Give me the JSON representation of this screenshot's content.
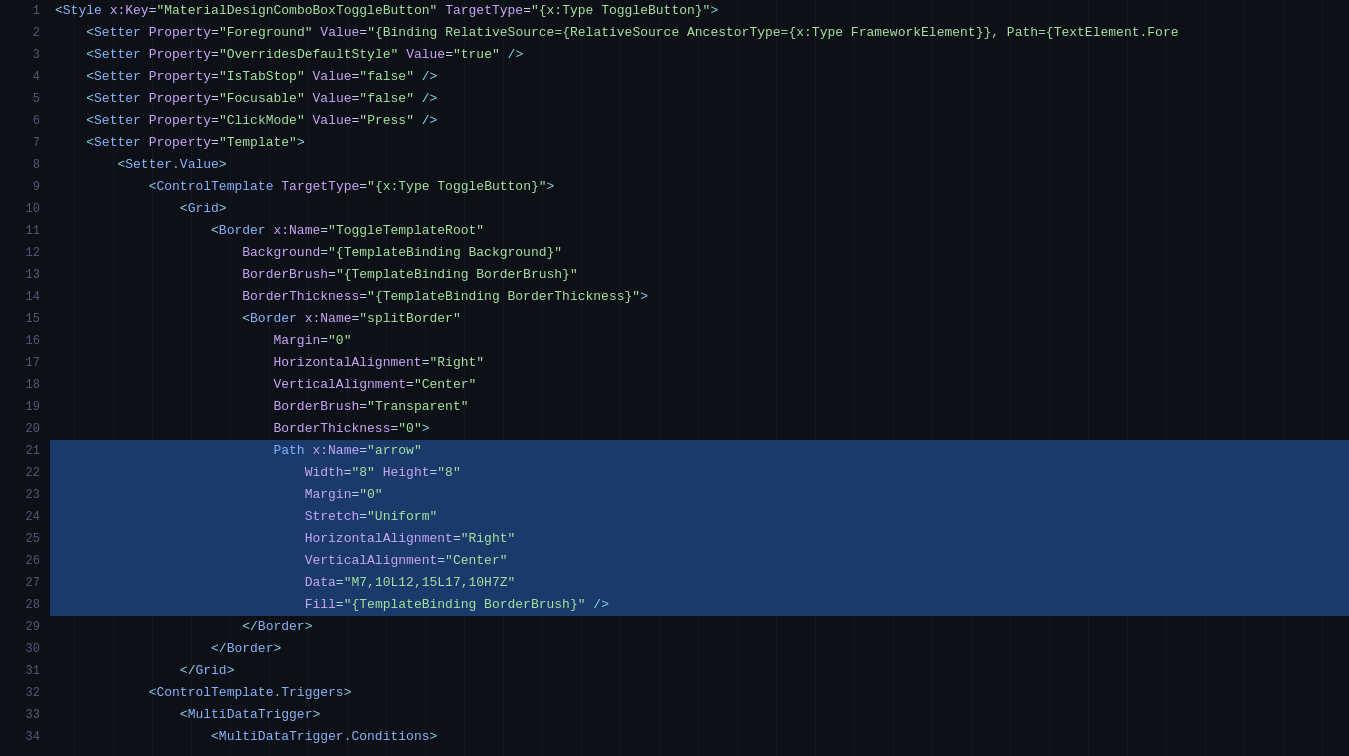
{
  "editor": {
    "background": "#0d1117",
    "lines": [
      {
        "number": 1,
        "indent": 0,
        "selected": false,
        "tokens": [
          {
            "type": "tag-bracket",
            "text": "<"
          },
          {
            "type": "tag-name",
            "text": "Style"
          },
          {
            "type": "text-normal",
            "text": " "
          },
          {
            "type": "attr-name",
            "text": "x:Key"
          },
          {
            "type": "text-normal",
            "text": "="
          },
          {
            "type": "attr-value",
            "text": "\"MaterialDesignComboBoxToggleButton\""
          },
          {
            "type": "text-normal",
            "text": " "
          },
          {
            "type": "attr-name",
            "text": "TargetType"
          },
          {
            "type": "text-normal",
            "text": "="
          },
          {
            "type": "attr-value",
            "text": "\"{x:Type ToggleButton}\""
          },
          {
            "type": "tag-bracket",
            "text": ">"
          }
        ]
      },
      {
        "number": 2,
        "indent": 1,
        "selected": false,
        "tokens": [
          {
            "type": "tag-bracket",
            "text": "<"
          },
          {
            "type": "tag-name",
            "text": "Setter"
          },
          {
            "type": "text-normal",
            "text": " "
          },
          {
            "type": "attr-name",
            "text": "Property"
          },
          {
            "type": "text-normal",
            "text": "="
          },
          {
            "type": "attr-value",
            "text": "\"Foreground\""
          },
          {
            "type": "text-normal",
            "text": " "
          },
          {
            "type": "attr-name",
            "text": "Value"
          },
          {
            "type": "text-normal",
            "text": "="
          },
          {
            "type": "attr-value",
            "text": "\"{Binding RelativeSource={RelativeSource AncestorType={x:Type FrameworkElement}}, Path={TextElement.Fore"
          }
        ]
      },
      {
        "number": 3,
        "indent": 1,
        "selected": false,
        "tokens": [
          {
            "type": "tag-bracket",
            "text": "<"
          },
          {
            "type": "tag-name",
            "text": "Setter"
          },
          {
            "type": "text-normal",
            "text": " "
          },
          {
            "type": "attr-name",
            "text": "Property"
          },
          {
            "type": "text-normal",
            "text": "="
          },
          {
            "type": "attr-value",
            "text": "\"OverridesDefaultStyle\""
          },
          {
            "type": "text-normal",
            "text": " "
          },
          {
            "type": "attr-name",
            "text": "Value"
          },
          {
            "type": "text-normal",
            "text": "="
          },
          {
            "type": "attr-value",
            "text": "\"true\""
          },
          {
            "type": "text-normal",
            "text": " "
          },
          {
            "type": "slash",
            "text": "/>"
          }
        ]
      },
      {
        "number": 4,
        "indent": 1,
        "selected": false,
        "tokens": [
          {
            "type": "tag-bracket",
            "text": "<"
          },
          {
            "type": "tag-name",
            "text": "Setter"
          },
          {
            "type": "text-normal",
            "text": " "
          },
          {
            "type": "attr-name",
            "text": "Property"
          },
          {
            "type": "text-normal",
            "text": "="
          },
          {
            "type": "attr-value",
            "text": "\"IsTabStop\""
          },
          {
            "type": "text-normal",
            "text": " "
          },
          {
            "type": "attr-name",
            "text": "Value"
          },
          {
            "type": "text-normal",
            "text": "="
          },
          {
            "type": "attr-value",
            "text": "\"false\""
          },
          {
            "type": "text-normal",
            "text": " "
          },
          {
            "type": "slash",
            "text": "/>"
          }
        ]
      },
      {
        "number": 5,
        "indent": 1,
        "selected": false,
        "tokens": [
          {
            "type": "tag-bracket",
            "text": "<"
          },
          {
            "type": "tag-name",
            "text": "Setter"
          },
          {
            "type": "text-normal",
            "text": " "
          },
          {
            "type": "attr-name",
            "text": "Property"
          },
          {
            "type": "text-normal",
            "text": "="
          },
          {
            "type": "attr-value",
            "text": "\"Focusable\""
          },
          {
            "type": "text-normal",
            "text": " "
          },
          {
            "type": "attr-name",
            "text": "Value"
          },
          {
            "type": "text-normal",
            "text": "="
          },
          {
            "type": "attr-value",
            "text": "\"false\""
          },
          {
            "type": "text-normal",
            "text": " "
          },
          {
            "type": "slash",
            "text": "/>"
          }
        ]
      },
      {
        "number": 6,
        "indent": 1,
        "selected": false,
        "tokens": [
          {
            "type": "tag-bracket",
            "text": "<"
          },
          {
            "type": "tag-name",
            "text": "Setter"
          },
          {
            "type": "text-normal",
            "text": " "
          },
          {
            "type": "attr-name",
            "text": "Property"
          },
          {
            "type": "text-normal",
            "text": "="
          },
          {
            "type": "attr-value",
            "text": "\"ClickMode\""
          },
          {
            "type": "text-normal",
            "text": " "
          },
          {
            "type": "attr-name",
            "text": "Value"
          },
          {
            "type": "text-normal",
            "text": "="
          },
          {
            "type": "attr-value",
            "text": "\"Press\""
          },
          {
            "type": "text-normal",
            "text": " "
          },
          {
            "type": "slash",
            "text": "/>"
          }
        ]
      },
      {
        "number": 7,
        "indent": 1,
        "selected": false,
        "tokens": [
          {
            "type": "tag-bracket",
            "text": "<"
          },
          {
            "type": "tag-name",
            "text": "Setter"
          },
          {
            "type": "text-normal",
            "text": " "
          },
          {
            "type": "attr-name",
            "text": "Property"
          },
          {
            "type": "text-normal",
            "text": "="
          },
          {
            "type": "attr-value",
            "text": "\"Template\""
          },
          {
            "type": "tag-bracket",
            "text": ">"
          }
        ]
      },
      {
        "number": 8,
        "indent": 2,
        "selected": false,
        "tokens": [
          {
            "type": "tag-bracket",
            "text": "<"
          },
          {
            "type": "tag-name",
            "text": "Setter.Value"
          },
          {
            "type": "tag-bracket",
            "text": ">"
          }
        ]
      },
      {
        "number": 9,
        "indent": 3,
        "selected": false,
        "tokens": [
          {
            "type": "tag-bracket",
            "text": "<"
          },
          {
            "type": "tag-name",
            "text": "ControlTemplate"
          },
          {
            "type": "text-normal",
            "text": " "
          },
          {
            "type": "attr-name",
            "text": "TargetType"
          },
          {
            "type": "text-normal",
            "text": "="
          },
          {
            "type": "attr-value",
            "text": "\"{x:Type ToggleButton}\""
          },
          {
            "type": "tag-bracket",
            "text": ">"
          }
        ]
      },
      {
        "number": 10,
        "indent": 4,
        "selected": false,
        "tokens": [
          {
            "type": "tag-bracket",
            "text": "<"
          },
          {
            "type": "tag-name",
            "text": "Grid"
          },
          {
            "type": "tag-bracket",
            "text": ">"
          }
        ]
      },
      {
        "number": 11,
        "indent": 5,
        "selected": false,
        "tokens": [
          {
            "type": "tag-bracket",
            "text": "<"
          },
          {
            "type": "tag-name",
            "text": "Border"
          },
          {
            "type": "text-normal",
            "text": " "
          },
          {
            "type": "attr-name",
            "text": "x:Name"
          },
          {
            "type": "text-normal",
            "text": "="
          },
          {
            "type": "attr-value",
            "text": "\"ToggleTemplateRoot\""
          }
        ]
      },
      {
        "number": 12,
        "indent": 6,
        "selected": false,
        "tokens": [
          {
            "type": "attr-name",
            "text": "Background"
          },
          {
            "type": "text-normal",
            "text": "="
          },
          {
            "type": "attr-value",
            "text": "\"{TemplateBinding Background}\""
          }
        ]
      },
      {
        "number": 13,
        "indent": 6,
        "selected": false,
        "tokens": [
          {
            "type": "attr-name",
            "text": "BorderBrush"
          },
          {
            "type": "text-normal",
            "text": "="
          },
          {
            "type": "attr-value",
            "text": "\"{TemplateBinding BorderBrush}\""
          }
        ]
      },
      {
        "number": 14,
        "indent": 6,
        "selected": false,
        "tokens": [
          {
            "type": "attr-name",
            "text": "BorderThickness"
          },
          {
            "type": "text-normal",
            "text": "="
          },
          {
            "type": "attr-value",
            "text": "\"{TemplateBinding BorderThickness}\""
          },
          {
            "type": "tag-bracket",
            "text": ">"
          }
        ]
      },
      {
        "number": 15,
        "indent": 6,
        "selected": false,
        "tokens": [
          {
            "type": "tag-bracket",
            "text": "<"
          },
          {
            "type": "tag-name",
            "text": "Border"
          },
          {
            "type": "text-normal",
            "text": " "
          },
          {
            "type": "attr-name",
            "text": "x:Name"
          },
          {
            "type": "text-normal",
            "text": "="
          },
          {
            "type": "attr-value",
            "text": "\"splitBorder\""
          }
        ]
      },
      {
        "number": 16,
        "indent": 7,
        "selected": false,
        "tokens": [
          {
            "type": "attr-name",
            "text": "Margin"
          },
          {
            "type": "text-normal",
            "text": "="
          },
          {
            "type": "attr-value",
            "text": "\"0\""
          }
        ]
      },
      {
        "number": 17,
        "indent": 7,
        "selected": false,
        "tokens": [
          {
            "type": "attr-name",
            "text": "HorizontalAlignment"
          },
          {
            "type": "text-normal",
            "text": "="
          },
          {
            "type": "attr-value",
            "text": "\"Right\""
          }
        ]
      },
      {
        "number": 18,
        "indent": 7,
        "selected": false,
        "tokens": [
          {
            "type": "attr-name",
            "text": "VerticalAlignment"
          },
          {
            "type": "text-normal",
            "text": "="
          },
          {
            "type": "attr-value",
            "text": "\"Center\""
          }
        ]
      },
      {
        "number": 19,
        "indent": 7,
        "selected": false,
        "tokens": [
          {
            "type": "attr-name",
            "text": "BorderBrush"
          },
          {
            "type": "text-normal",
            "text": "="
          },
          {
            "type": "attr-value",
            "text": "\"Transparent\""
          }
        ]
      },
      {
        "number": 20,
        "indent": 7,
        "selected": false,
        "tokens": [
          {
            "type": "attr-name",
            "text": "BorderThickness"
          },
          {
            "type": "text-normal",
            "text": "="
          },
          {
            "type": "attr-value",
            "text": "\"0\""
          },
          {
            "type": "tag-bracket",
            "text": ">"
          }
        ]
      },
      {
        "number": 21,
        "indent": 7,
        "selected": true,
        "selectedStart": true,
        "tokens": [
          {
            "type": "tag-name-selected",
            "text": "Path"
          },
          {
            "type": "text-selected",
            "text": " "
          },
          {
            "type": "attr-name-selected",
            "text": "x:Name"
          },
          {
            "type": "text-selected",
            "text": "="
          },
          {
            "type": "attr-value-selected",
            "text": "\"arrow\""
          }
        ]
      },
      {
        "number": 22,
        "indent": 8,
        "selected": true,
        "tokens": [
          {
            "type": "attr-selected",
            "text": "Width"
          },
          {
            "type": "text-selected",
            "text": "="
          },
          {
            "type": "val-selected",
            "text": "\"8\""
          },
          {
            "type": "text-selected",
            "text": " "
          },
          {
            "type": "attr-selected",
            "text": "Height"
          },
          {
            "type": "text-selected",
            "text": "="
          },
          {
            "type": "val-selected",
            "text": "\"8\""
          }
        ]
      },
      {
        "number": 23,
        "indent": 8,
        "selected": true,
        "tokens": [
          {
            "type": "attr-selected",
            "text": "Margin"
          },
          {
            "type": "text-selected",
            "text": "="
          },
          {
            "type": "val-selected",
            "text": "\"0\""
          }
        ]
      },
      {
        "number": 24,
        "indent": 8,
        "selected": true,
        "tokens": [
          {
            "type": "attr-selected",
            "text": "Stretch"
          },
          {
            "type": "text-selected",
            "text": "="
          },
          {
            "type": "val-selected",
            "text": "\"Uniform\""
          }
        ]
      },
      {
        "number": 25,
        "indent": 8,
        "selected": true,
        "tokens": [
          {
            "type": "attr-selected",
            "text": "HorizontalAlignment"
          },
          {
            "type": "text-selected",
            "text": "="
          },
          {
            "type": "val-selected",
            "text": "\"Right\""
          }
        ]
      },
      {
        "number": 26,
        "indent": 8,
        "selected": true,
        "tokens": [
          {
            "type": "attr-selected",
            "text": "VerticalAlignment"
          },
          {
            "type": "text-selected",
            "text": "="
          },
          {
            "type": "val-selected",
            "text": "\"Center\""
          }
        ]
      },
      {
        "number": 27,
        "indent": 8,
        "selected": true,
        "tokens": [
          {
            "type": "attr-selected",
            "text": "Data"
          },
          {
            "type": "text-selected",
            "text": "="
          },
          {
            "type": "val-selected",
            "text": "\"M7,10L12,15L17,10H7Z\""
          }
        ]
      },
      {
        "number": 28,
        "indent": 8,
        "selected": true,
        "selectedEnd": true,
        "tokens": [
          {
            "type": "attr-selected",
            "text": "Fill"
          },
          {
            "type": "text-selected",
            "text": "="
          },
          {
            "type": "val-selected",
            "text": "\"{TemplateBinding BorderBrush}\""
          },
          {
            "type": "text-selected",
            "text": " "
          },
          {
            "type": "slash-selected",
            "text": "/>"
          }
        ]
      },
      {
        "number": 29,
        "indent": 6,
        "selected": false,
        "tokens": [
          {
            "type": "tag-bracket",
            "text": "</"
          },
          {
            "type": "tag-name",
            "text": "Border"
          },
          {
            "type": "tag-bracket",
            "text": ">"
          }
        ]
      },
      {
        "number": 30,
        "indent": 5,
        "selected": false,
        "tokens": [
          {
            "type": "tag-bracket",
            "text": "</"
          },
          {
            "type": "tag-name",
            "text": "Border"
          },
          {
            "type": "tag-bracket",
            "text": ">"
          }
        ]
      },
      {
        "number": 31,
        "indent": 4,
        "selected": false,
        "tokens": [
          {
            "type": "tag-bracket",
            "text": "</"
          },
          {
            "type": "tag-name",
            "text": "Grid"
          },
          {
            "type": "tag-bracket",
            "text": ">"
          }
        ]
      },
      {
        "number": 32,
        "indent": 3,
        "selected": false,
        "tokens": [
          {
            "type": "tag-bracket",
            "text": "<"
          },
          {
            "type": "tag-name",
            "text": "ControlTemplate.Triggers"
          },
          {
            "type": "tag-bracket",
            "text": ">"
          }
        ]
      },
      {
        "number": 33,
        "indent": 4,
        "selected": false,
        "tokens": [
          {
            "type": "tag-bracket",
            "text": "<"
          },
          {
            "type": "tag-name",
            "text": "MultiDataTrigger"
          },
          {
            "type": "tag-bracket",
            "text": ">"
          }
        ]
      },
      {
        "number": 34,
        "indent": 5,
        "selected": false,
        "tokens": [
          {
            "type": "tag-bracket",
            "text": "<"
          },
          {
            "type": "tag-name",
            "text": "MultiDataTrigger.Conditions"
          },
          {
            "type": "tag-bracket",
            "text": ">"
          }
        ]
      }
    ]
  }
}
